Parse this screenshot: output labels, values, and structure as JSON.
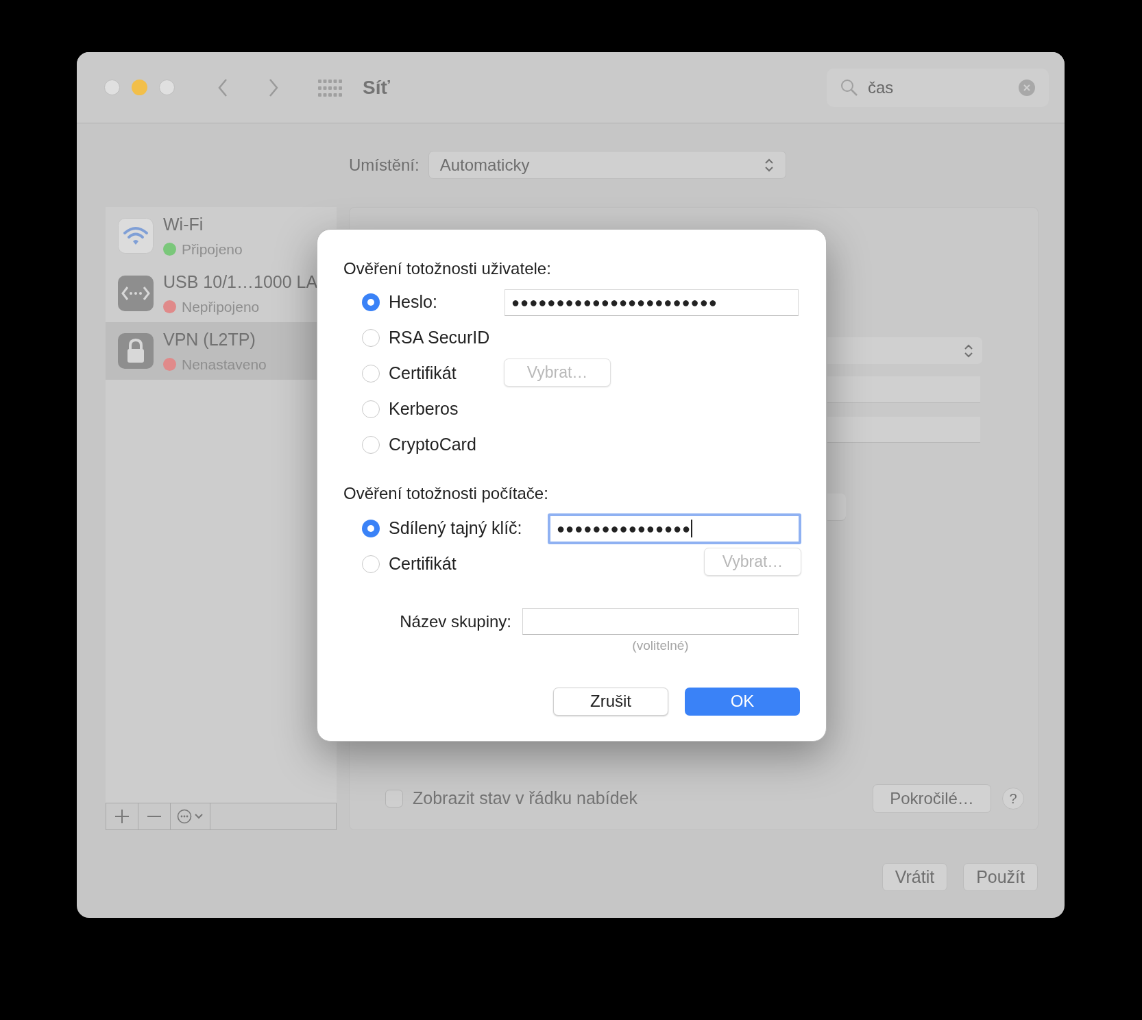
{
  "window": {
    "title": "Síť"
  },
  "search": {
    "value": "čas"
  },
  "location": {
    "label": "Umístění:",
    "value": "Automaticky"
  },
  "sidebar": {
    "items": [
      {
        "kind": "wifi",
        "name": "Wi-Fi",
        "status": "Připojeno",
        "color": "#7ac77a",
        "selected": false
      },
      {
        "kind": "ethernet",
        "name": "USB 10/1…1000 LA",
        "status": "Nepřipojeno",
        "color": "#e08a8a",
        "selected": false
      },
      {
        "kind": "lock",
        "name": "VPN (L2TP)",
        "status": "Nenastaveno",
        "color": "#e08a8a",
        "selected": true
      }
    ]
  },
  "panel": {
    "show_status": {
      "label": "Zobrazit stav v řádku nabídek",
      "checked": false
    },
    "advanced_button": "Pokročilé…",
    "help_button": "?"
  },
  "footer_buttons": [
    "Vrátit",
    "Použít"
  ],
  "dialog": {
    "user_auth": {
      "heading": "Ověření totožnosti uživatele:",
      "options": [
        {
          "kind": "password",
          "label": "Heslo:",
          "selected": true,
          "value": "●●●●●●●●●●●●●●●●●●●●●●●",
          "focused": false
        },
        {
          "kind": "plain",
          "label": "RSA SecurID",
          "selected": false
        },
        {
          "kind": "choose",
          "label": "Certifikát",
          "selected": false,
          "button": "Vybrat…",
          "disabled": true
        },
        {
          "kind": "plain",
          "label": "Kerberos",
          "selected": false
        },
        {
          "kind": "plain",
          "label": "CryptoCard",
          "selected": false
        }
      ]
    },
    "machine_auth": {
      "heading": "Ověření totožnosti počítače:",
      "options": [
        {
          "kind": "password",
          "label": "Sdílený tajný klíč:",
          "selected": true,
          "value": "●●●●●●●●●●●●●●●",
          "focused": true
        },
        {
          "kind": "choose",
          "label": "Certifikát",
          "selected": false,
          "button": "Vybrat…",
          "disabled": true
        }
      ]
    },
    "group_name": {
      "label": "Název skupiny:",
      "hint": "(volitelné)"
    },
    "cancel_button": "Zrušit",
    "ok_button": "OK"
  }
}
